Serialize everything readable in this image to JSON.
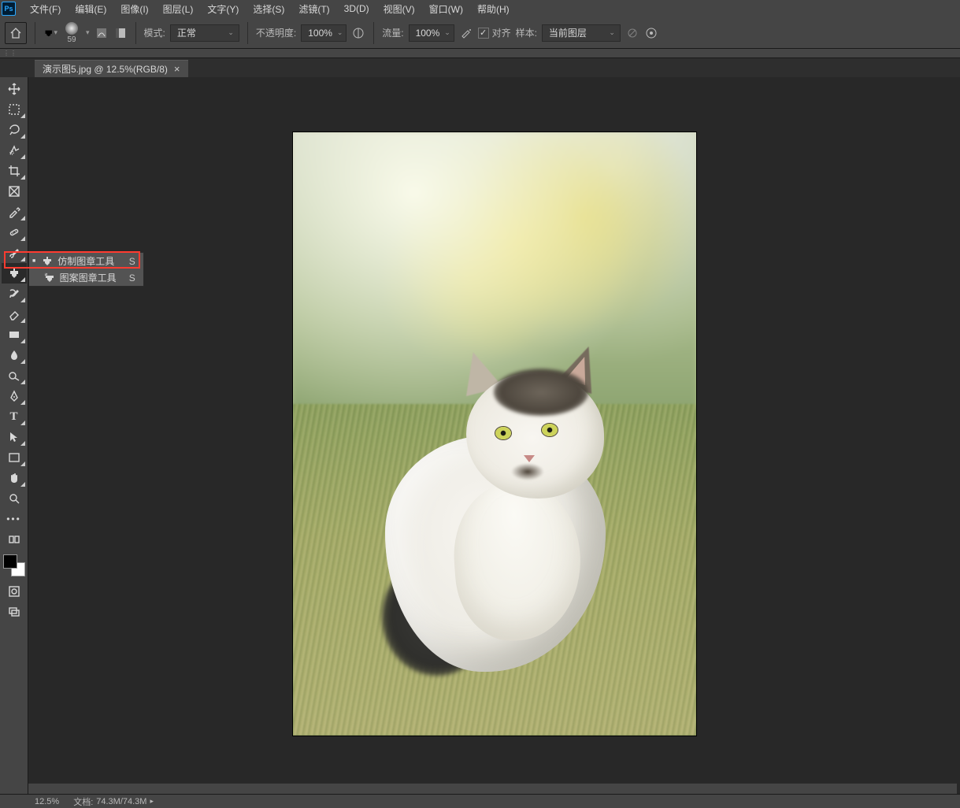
{
  "menu": [
    "文件(F)",
    "编辑(E)",
    "图像(I)",
    "图层(L)",
    "文字(Y)",
    "选择(S)",
    "滤镜(T)",
    "3D(D)",
    "视图(V)",
    "窗口(W)",
    "帮助(H)"
  ],
  "options": {
    "brush_size": "59",
    "mode_label": "模式:",
    "mode_value": "正常",
    "opacity_label": "不透明度:",
    "opacity_value": "100%",
    "flow_label": "流量:",
    "flow_value": "100%",
    "align_label": "对齐",
    "align_checked": true,
    "sample_label": "样本:",
    "sample_value": "当前图层"
  },
  "tab": {
    "title": "演示图5.jpg @ 12.5%(RGB/8)"
  },
  "toolbox": {
    "tools": [
      {
        "name": "move-tool",
        "glyph": "move",
        "fly": false
      },
      {
        "name": "marquee-tool",
        "glyph": "marquee",
        "fly": true
      },
      {
        "name": "lasso-tool",
        "glyph": "lasso",
        "fly": true
      },
      {
        "name": "quick-select-tool",
        "glyph": "wand",
        "fly": true
      },
      {
        "name": "crop-tool",
        "glyph": "crop",
        "fly": true
      },
      {
        "name": "frame-tool",
        "glyph": "frame",
        "fly": false
      },
      {
        "name": "eyedropper-tool",
        "glyph": "eyedropper",
        "fly": true
      },
      {
        "name": "healing-tool",
        "glyph": "bandaid",
        "fly": true
      },
      {
        "name": "brush-tool",
        "glyph": "brush",
        "fly": true
      },
      {
        "name": "clone-stamp-tool",
        "glyph": "stamp",
        "fly": true,
        "selected": true
      },
      {
        "name": "history-brush-tool",
        "glyph": "history",
        "fly": true
      },
      {
        "name": "eraser-tool",
        "glyph": "eraser",
        "fly": true
      },
      {
        "name": "gradient-tool",
        "glyph": "gradient",
        "fly": true
      },
      {
        "name": "blur-tool",
        "glyph": "blur",
        "fly": true
      },
      {
        "name": "dodge-tool",
        "glyph": "dodge",
        "fly": true
      },
      {
        "name": "pen-tool",
        "glyph": "pen",
        "fly": true
      },
      {
        "name": "type-tool",
        "glyph": "type",
        "fly": true
      },
      {
        "name": "path-select-tool",
        "glyph": "pathsel",
        "fly": true
      },
      {
        "name": "rectangle-tool",
        "glyph": "rect",
        "fly": true
      },
      {
        "name": "hand-tool",
        "glyph": "hand",
        "fly": true
      },
      {
        "name": "zoom-tool",
        "glyph": "zoom",
        "fly": false
      },
      {
        "name": "more-tools",
        "glyph": "dots",
        "fly": false
      },
      {
        "name": "edit-toolbar",
        "glyph": "edit",
        "fly": false
      }
    ]
  },
  "flyout": {
    "items": [
      {
        "label": "仿制图章工具",
        "shortcut": "S",
        "selected": true
      },
      {
        "label": "图案图章工具",
        "shortcut": "S",
        "selected": false
      }
    ]
  },
  "status": {
    "zoom": "12.5%",
    "doc_label": "文档:",
    "doc_value": "74.3M/74.3M"
  }
}
